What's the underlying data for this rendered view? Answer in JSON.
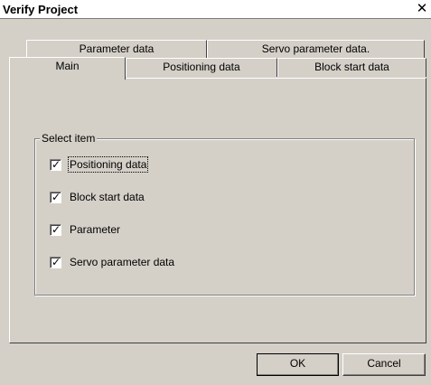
{
  "window": {
    "title": "Verify Project"
  },
  "tabs": {
    "back_row": [
      "Parameter data",
      "Servo parameter data."
    ],
    "front_row": [
      "Main",
      "Positioning data",
      "Block start data"
    ],
    "active": "Main"
  },
  "select_group": {
    "label": "Select item",
    "items": [
      {
        "label": "Positioning data",
        "checked": true
      },
      {
        "label": "Block start data",
        "checked": true
      },
      {
        "label": "Parameter",
        "checked": true
      },
      {
        "label": "Servo parameter data",
        "checked": true
      }
    ]
  },
  "buttons": {
    "ok": "OK",
    "cancel": "Cancel"
  },
  "icons": {
    "close": "close-icon",
    "check": "checkmark-icon"
  }
}
